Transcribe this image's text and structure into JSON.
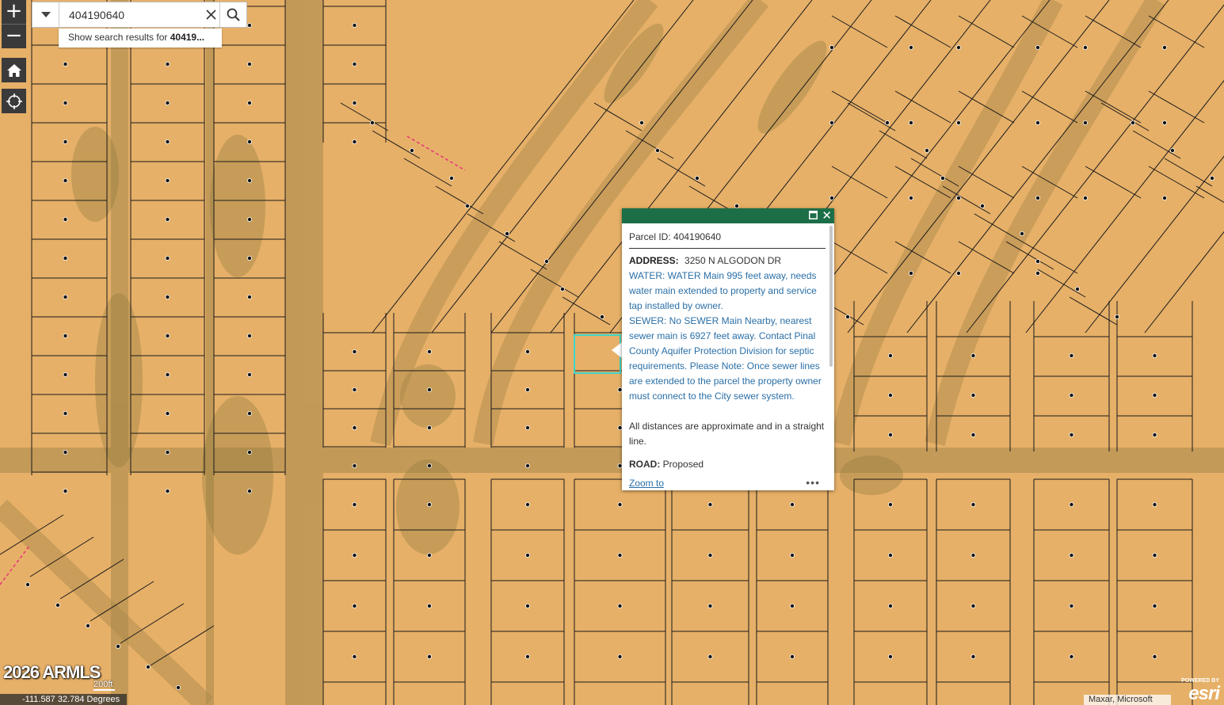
{
  "map": {
    "basemap_color": "#e6b068",
    "parcel_line_color": "#1a1a1a",
    "highlight_color": "#3fd5c8",
    "easement_color": "#e8357a"
  },
  "controls": {
    "zoom_in": "+",
    "zoom_out": "−",
    "home_icon": "home-icon",
    "locate_icon": "locate-icon"
  },
  "search": {
    "value": "404190640",
    "suggestion_prefix": "Show search results for ",
    "suggestion_term": "40419..."
  },
  "popup": {
    "header_color": "#1c6e47",
    "parcel_id": "Parcel ID: 404190640",
    "address_label": "ADDRESS:",
    "address_value": "3250 N ALGODON DR",
    "water": "WATER: WATER Main 995 feet away, needs water main extended to property and service tap installed by owner.",
    "sewer": "SEWER: No SEWER Main Nearby, nearest sewer main is 6927 feet away. Contact Pinal County Aquifer Protection Division for septic requirements. Please Note: Once sewer lines are extended to the parcel the property owner must connect to the City sewer system.",
    "distances_note": "All distances are approximate and in a straight line.",
    "road_label": "ROAD:",
    "road_value": "Proposed",
    "zoom_to": "Zoom to",
    "more": "•••"
  },
  "footer": {
    "watermark": "2026 ARMLS",
    "scale_label": "200ft",
    "coordinates": "-111.587 32.784 Degrees",
    "attribution": "Maxar, Microsoft",
    "powered_by": "POWERED BY",
    "logo_text": "esri"
  }
}
